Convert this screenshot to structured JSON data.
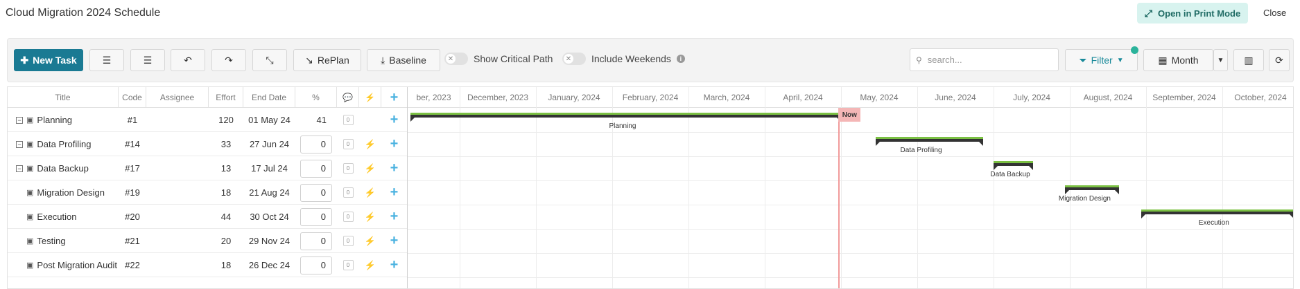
{
  "header": {
    "title": "Cloud Migration 2024 Schedule",
    "print_label": "Open in Print Mode",
    "close_label": "Close"
  },
  "toolbar": {
    "new_task_label": "New Task",
    "replan_label": "RePlan",
    "baseline_label": "Baseline",
    "critical_path_label": "Show Critical Path",
    "include_weekends_label": "Include Weekends",
    "search_placeholder": "search...",
    "filter_label": "Filter",
    "view_label": "Month",
    "accent_color": "#1a7a93"
  },
  "grid": {
    "columns": [
      "Title",
      "Code",
      "Assignee",
      "Effort",
      "End Date",
      "%"
    ],
    "rows": [
      {
        "title": "Planning",
        "code": "#1",
        "assignee": "",
        "effort": "120",
        "end_date": "01 May 24",
        "pct": "41",
        "comments": "0",
        "expandable": true
      },
      {
        "title": "Data Profiling",
        "code": "#14",
        "assignee": "",
        "effort": "33",
        "end_date": "27 Jun 24",
        "pct": "0",
        "comments": "0",
        "expandable": true
      },
      {
        "title": "Data Backup",
        "code": "#17",
        "assignee": "",
        "effort": "13",
        "end_date": "17 Jul 24",
        "pct": "0",
        "comments": "0",
        "expandable": true
      },
      {
        "title": "Migration Design",
        "code": "#19",
        "assignee": "",
        "effort": "18",
        "end_date": "21 Aug 24",
        "pct": "0",
        "comments": "0",
        "expandable": false
      },
      {
        "title": "Execution",
        "code": "#20",
        "assignee": "",
        "effort": "44",
        "end_date": "30 Oct 24",
        "pct": "0",
        "comments": "0",
        "expandable": false
      },
      {
        "title": "Testing",
        "code": "#21",
        "assignee": "",
        "effort": "20",
        "end_date": "29 Nov 24",
        "pct": "0",
        "comments": "0",
        "expandable": false
      },
      {
        "title": "Post Migration Audit",
        "code": "#22",
        "assignee": "",
        "effort": "18",
        "end_date": "26 Dec 24",
        "pct": "0",
        "comments": "0",
        "expandable": false
      }
    ]
  },
  "gantt": {
    "months": [
      "ber, 2023",
      "December, 2023",
      "January, 2024",
      "February, 2024",
      "March, 2024",
      "April, 2024",
      "May, 2024",
      "June, 2024",
      "July, 2024",
      "August, 2024",
      "September, 2024",
      "October, 2024"
    ],
    "now_label": "Now",
    "bars": [
      {
        "label": "Planning",
        "start": "2023-11-01",
        "end": "2024-05-01"
      },
      {
        "label": "Data Profiling",
        "start": "2024-05-15",
        "end": "2024-06-27"
      },
      {
        "label": "Data Backup",
        "start": "2024-07-01",
        "end": "2024-07-17"
      },
      {
        "label": "Migration Design",
        "start": "2024-07-30",
        "end": "2024-08-21"
      },
      {
        "label": "Execution",
        "start": "2024-08-30",
        "end": "2024-10-30"
      }
    ]
  }
}
